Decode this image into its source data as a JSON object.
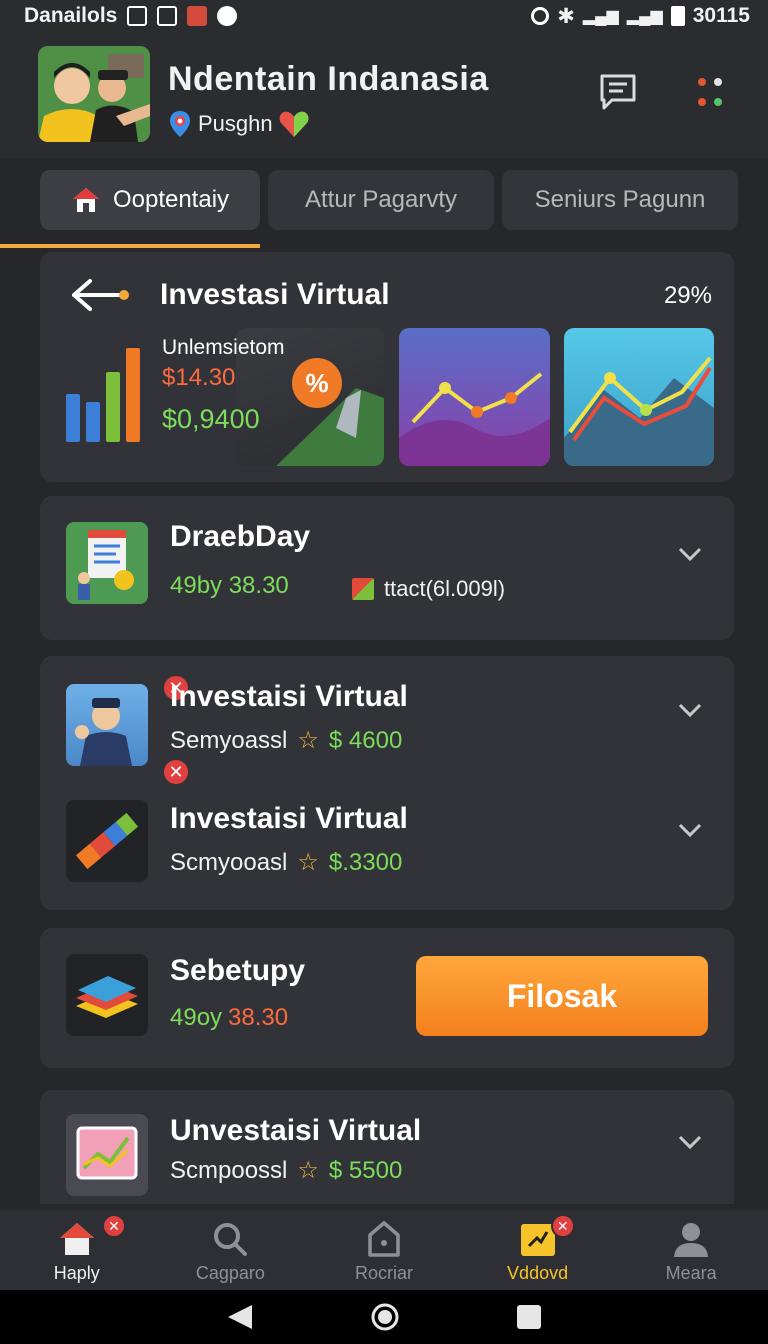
{
  "status_bar": {
    "left_text": "Danailols",
    "time": "30115"
  },
  "header": {
    "title": "Ndentain Indanasia",
    "location": "Pusghn"
  },
  "tabs": [
    {
      "label": "Ooptentaiy",
      "active": true
    },
    {
      "label": "Attur Pagarvty",
      "active": false
    },
    {
      "label": "Seniurs Pagunn",
      "active": false
    }
  ],
  "summary_card": {
    "title": "Investasi Virtual",
    "percent": "29%",
    "label": "Unlemsietom",
    "value_red": "$14.30",
    "value_green": "$0,9400"
  },
  "items": [
    {
      "title": "DraebDay",
      "value": "49by 38.30",
      "extra": "ttact(6l.009l)"
    },
    {
      "title": "Investaisi  Virtual",
      "sub": "Semyoassl",
      "price": "$ 4600"
    },
    {
      "title": "Investaisi Virtual",
      "sub": "Scmyooasl",
      "price": "$.3300"
    },
    {
      "title": "Sebetupy",
      "value_green": "49oy",
      "value_red": "38.30",
      "button": "Filosak"
    },
    {
      "title": "Unvestaisi Virtual",
      "sub": "Scmpoossl",
      "price": "$ 5500"
    }
  ],
  "bottom_nav": [
    {
      "label": "Haply",
      "icon": "home-icon"
    },
    {
      "label": "Cagparo",
      "icon": "search-icon"
    },
    {
      "label": "Rocriar",
      "icon": "bag-icon"
    },
    {
      "label": "Vddovd",
      "icon": "chart-icon"
    },
    {
      "label": "Meara",
      "icon": "profile-icon"
    }
  ],
  "colors": {
    "accent": "#f2a83b",
    "positive": "#7ddc5a",
    "negative": "#ff6a3d",
    "button": "#f4801f"
  }
}
